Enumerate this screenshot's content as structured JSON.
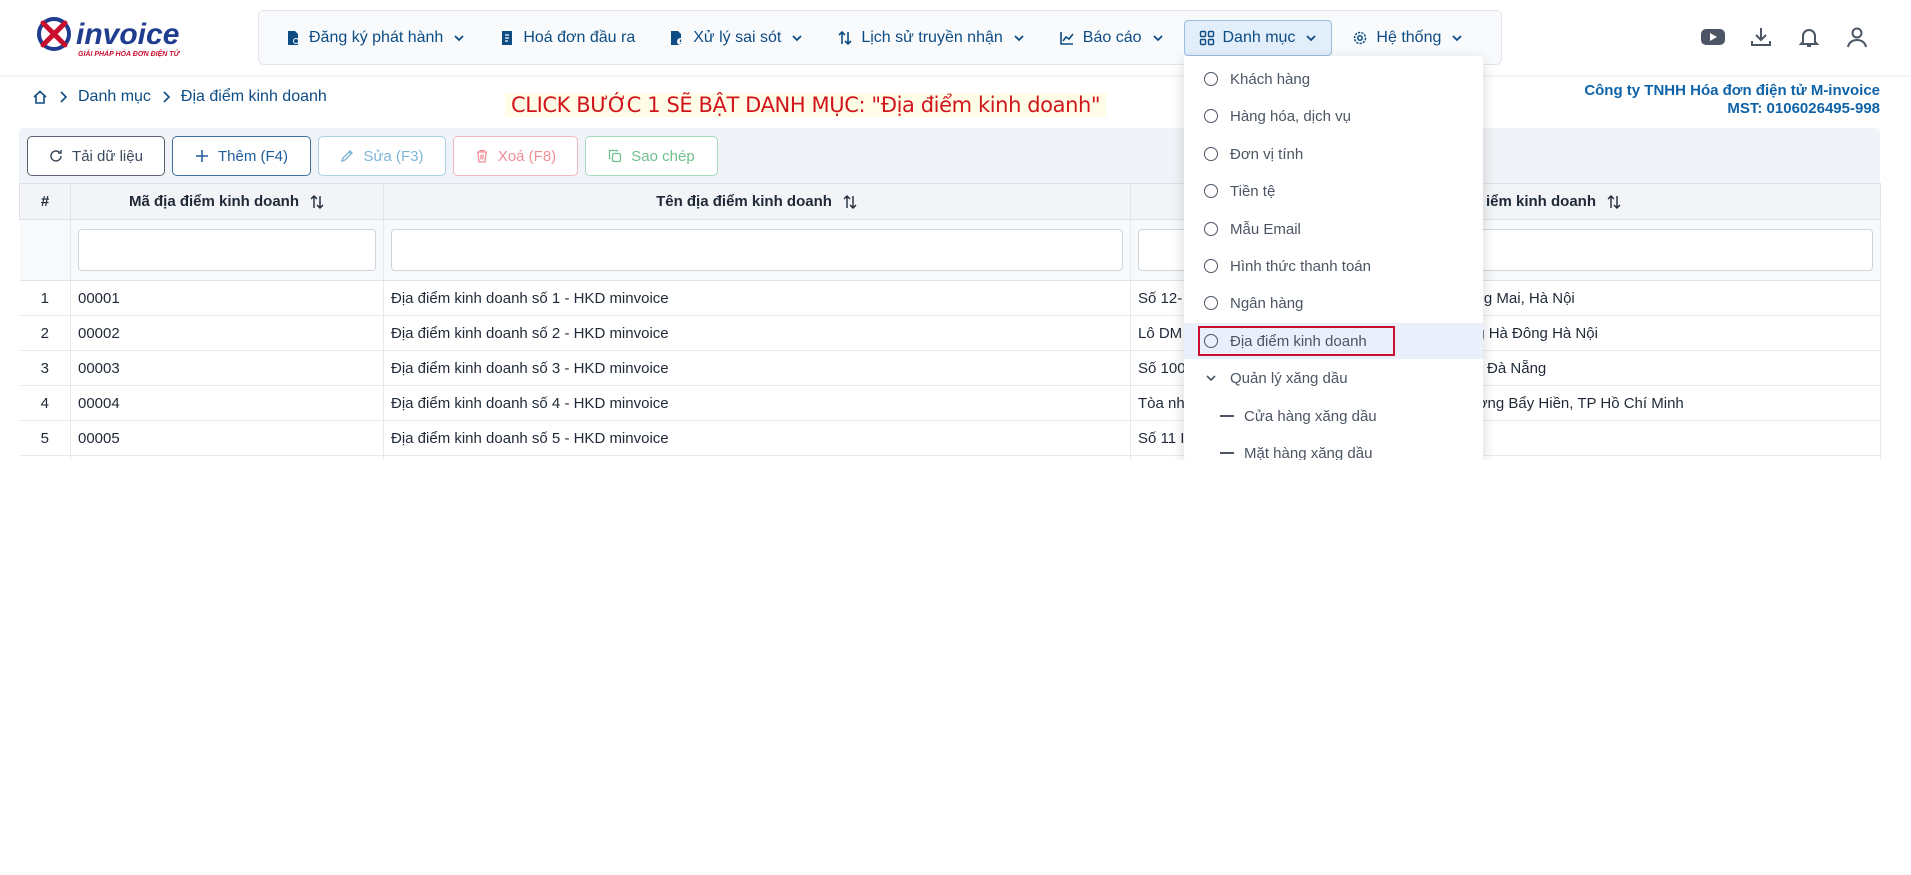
{
  "brand": {
    "logo_text": "invoice",
    "logo_tagline": "GIẢI PHÁP HÓA ĐƠN ĐIỆN TỬ"
  },
  "nav": {
    "items": [
      {
        "label": "Đăng ký phát hành",
        "icon": "file-icon",
        "has_dropdown": true
      },
      {
        "label": "Hoá đơn đầu ra",
        "icon": "invoice-icon",
        "has_dropdown": false
      },
      {
        "label": "Xử lý sai sót",
        "icon": "file-warning-icon",
        "has_dropdown": true
      },
      {
        "label": "Lịch sử truyền nhận",
        "icon": "arrows-updown-icon",
        "has_dropdown": true
      },
      {
        "label": "Báo cáo",
        "icon": "chart-icon",
        "has_dropdown": true
      },
      {
        "label": "Danh mục",
        "icon": "grid-icon",
        "has_dropdown": true,
        "active": true
      },
      {
        "label": "Hệ thống",
        "icon": "gear-icon",
        "has_dropdown": true
      }
    ]
  },
  "top_icons": [
    "youtube-icon",
    "download-icon",
    "bell-icon",
    "user-icon"
  ],
  "breadcrumb": {
    "home_icon": "home-icon",
    "items": [
      "Danh mục",
      "Địa điểm kinh doanh"
    ]
  },
  "hint": "CLICK BƯỚC 1 SẼ BẬT DANH MỤC: \"Địa điểm kinh doanh\"",
  "company": {
    "name": "Công ty TNHH Hóa đơn điện tử M-invoice",
    "tax": "MST: 0106026495-998"
  },
  "toolbar": {
    "reload": "Tải dữ liệu",
    "add": "Thêm (F4)",
    "edit": "Sửa (F3)",
    "delete": "Xoá (F8)",
    "copy": "Sao chép"
  },
  "table": {
    "columns": [
      "#",
      "Mã địa điểm kinh doanh",
      "Tên địa điểm kinh doanh",
      "Địa chỉ địa điểm kinh doanh"
    ],
    "column3_visible": "iểm kinh doanh",
    "rows": [
      {
        "num": "1",
        "code": "00001",
        "name": "Địa điểm kinh doanh số 1 - HKD minvoice",
        "addr_left": "Số 12-",
        "addr_right": "àng Mai, Hà Nội"
      },
      {
        "num": "2",
        "code": "00002",
        "name": "Địa điểm kinh doanh số 2 - HKD minvoice",
        "addr_left": "Lô DM",
        "addr_right": "g Hà Đông Hà Nội"
      },
      {
        "num": "3",
        "code": "00003",
        "name": "Địa điểm kinh doanh số 3 - HKD minvoice",
        "addr_left": "Số 100",
        "addr_right": "ố Đà Nẵng"
      },
      {
        "num": "4",
        "code": "00004",
        "name": "Địa điểm kinh doanh số 4 - HKD minvoice",
        "addr_left": "Tòa nh",
        "addr_right": "ờng Bẩy Hiền, TP Hồ Chí Minh"
      },
      {
        "num": "5",
        "code": "00005",
        "name": "Địa điểm kinh doanh số 5 - HKD minvoice",
        "addr_left": "Số 11 I",
        "addr_right": ""
      }
    ]
  },
  "dropdown": {
    "items": [
      {
        "label": "Khách hàng",
        "type": "radio"
      },
      {
        "label": "Hàng hóa, dịch vụ",
        "type": "radio"
      },
      {
        "label": "Đơn vị tính",
        "type": "radio"
      },
      {
        "label": "Tiền tệ",
        "type": "radio"
      },
      {
        "label": "Mẫu Email",
        "type": "radio"
      },
      {
        "label": "Hình thức thanh toán",
        "type": "radio"
      },
      {
        "label": "Ngân hàng",
        "type": "radio"
      },
      {
        "label": "Địa điểm kinh doanh",
        "type": "radio",
        "highlighted": true
      },
      {
        "label": "Quản lý xăng dầu",
        "type": "group"
      },
      {
        "label": "Cửa hàng xăng dầu",
        "type": "sub"
      },
      {
        "label": "Mặt hàng xăng dầu",
        "type": "sub"
      }
    ]
  },
  "colors": {
    "primary": "#0e4c84",
    "highlight_border": "#c8102e",
    "hint_text": "#d0161c"
  }
}
